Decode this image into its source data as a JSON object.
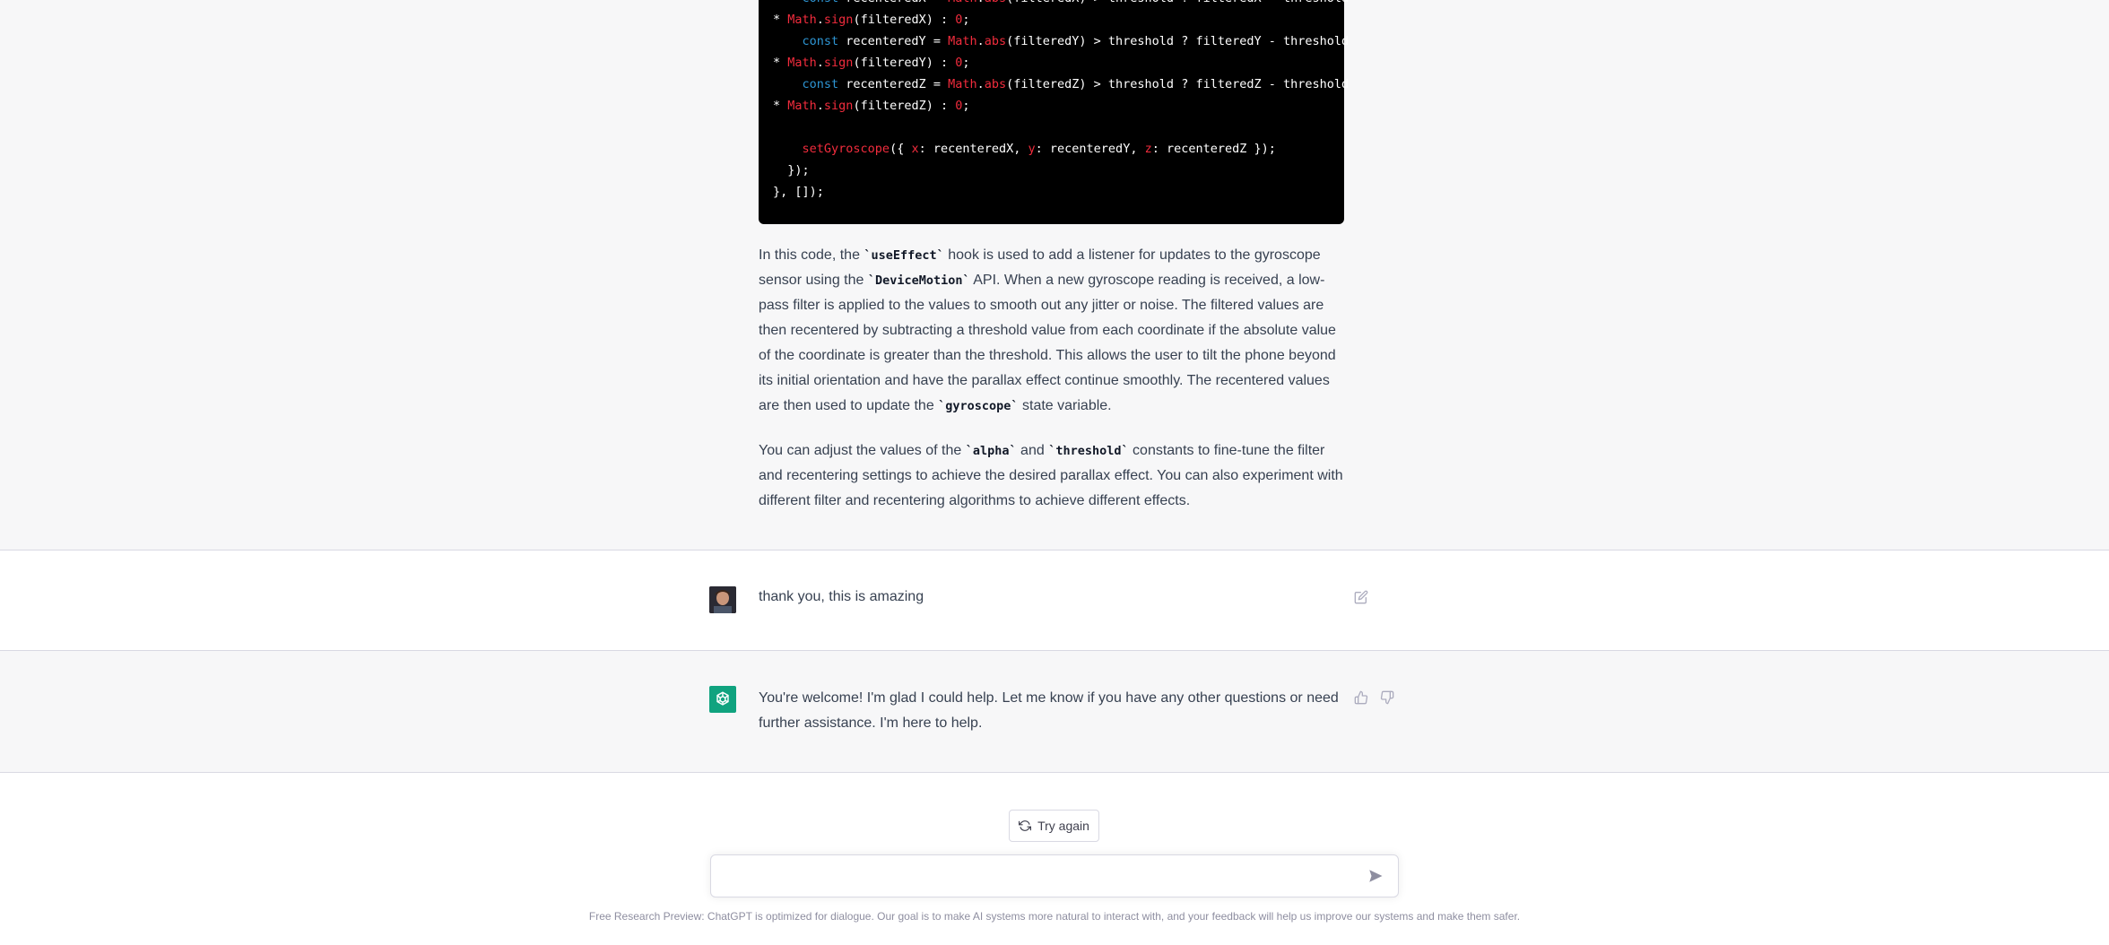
{
  "code": {
    "lines": [
      {
        "indent": "    ",
        "parts": [
          [
            "kw",
            "const"
          ],
          [
            "plain",
            " recenteredX = "
          ],
          [
            "fn",
            "Math"
          ],
          [
            "plain",
            "."
          ],
          [
            "fn",
            "abs"
          ],
          [
            "plain",
            "(filteredX) > threshold ? filteredX - threshold"
          ]
        ]
      },
      {
        "indent": "",
        "parts": [
          [
            "plain",
            "* "
          ],
          [
            "fn",
            "Math"
          ],
          [
            "plain",
            "."
          ],
          [
            "fn",
            "sign"
          ],
          [
            "plain",
            "(filteredX) : "
          ],
          [
            "red",
            "0"
          ],
          [
            "plain",
            ";"
          ]
        ]
      },
      {
        "indent": "    ",
        "parts": [
          [
            "kw",
            "const"
          ],
          [
            "plain",
            " recenteredY = "
          ],
          [
            "fn",
            "Math"
          ],
          [
            "plain",
            "."
          ],
          [
            "fn",
            "abs"
          ],
          [
            "plain",
            "(filteredY) > threshold ? filteredY - threshold"
          ]
        ]
      },
      {
        "indent": "",
        "parts": [
          [
            "plain",
            "* "
          ],
          [
            "fn",
            "Math"
          ],
          [
            "plain",
            "."
          ],
          [
            "fn",
            "sign"
          ],
          [
            "plain",
            "(filteredY) : "
          ],
          [
            "red",
            "0"
          ],
          [
            "plain",
            ";"
          ]
        ]
      },
      {
        "indent": "    ",
        "parts": [
          [
            "kw",
            "const"
          ],
          [
            "plain",
            " recenteredZ = "
          ],
          [
            "fn",
            "Math"
          ],
          [
            "plain",
            "."
          ],
          [
            "fn",
            "abs"
          ],
          [
            "plain",
            "(filteredZ) > threshold ? filteredZ - threshold"
          ]
        ]
      },
      {
        "indent": "",
        "parts": [
          [
            "plain",
            "* "
          ],
          [
            "fn",
            "Math"
          ],
          [
            "plain",
            "."
          ],
          [
            "fn",
            "sign"
          ],
          [
            "plain",
            "(filteredZ) : "
          ],
          [
            "red",
            "0"
          ],
          [
            "plain",
            ";"
          ]
        ]
      },
      {
        "indent": "",
        "parts": []
      },
      {
        "indent": "    ",
        "parts": [
          [
            "fn",
            "setGyroscope"
          ],
          [
            "plain",
            "({ "
          ],
          [
            "red",
            "x"
          ],
          [
            "plain",
            ": recenteredX, "
          ],
          [
            "red",
            "y"
          ],
          [
            "plain",
            ": recenteredY, "
          ],
          [
            "red",
            "z"
          ],
          [
            "plain",
            ": recenteredZ });"
          ]
        ]
      },
      {
        "indent": "  ",
        "parts": [
          [
            "plain",
            "});"
          ]
        ]
      },
      {
        "indent": "",
        "parts": [
          [
            "plain",
            "}, []);"
          ]
        ]
      }
    ]
  },
  "explanation": {
    "p1_parts": [
      [
        "text",
        "In this code, the "
      ],
      [
        "code",
        "`useEffect`"
      ],
      [
        "text",
        " hook is used to add a listener for updates to the gyroscope sensor using the "
      ],
      [
        "code",
        "`DeviceMotion`"
      ],
      [
        "text",
        " API. When a new gyroscope reading is received, a low-pass filter is applied to the values to smooth out any jitter or noise. The filtered values are then recentered by subtracting a threshold value from each coordinate if the absolute value of the coordinate is greater than the threshold. This allows the user to tilt the phone beyond its initial orientation and have the parallax effect continue smoothly. The recentered values are then used to update the "
      ],
      [
        "code",
        "`gyroscope`"
      ],
      [
        "text",
        " state variable."
      ]
    ],
    "p2_parts": [
      [
        "text",
        "You can adjust the values of the "
      ],
      [
        "code",
        "`alpha`"
      ],
      [
        "text",
        " and "
      ],
      [
        "code",
        "`threshold`"
      ],
      [
        "text",
        " constants to fine-tune the filter and recentering settings to achieve the desired parallax effect. You can also experiment with different filter and recentering algorithms to achieve different effects."
      ]
    ]
  },
  "user_message": {
    "text": "thank you, this is amazing",
    "edit_icon": "edit-icon"
  },
  "assistant_message": {
    "text": "You're welcome! I'm glad I could help. Let me know if you have any other questions or need further assistance. I'm here to help.",
    "thumbs_up_icon": "thumbs-up-icon",
    "thumbs_down_icon": "thumbs-down-icon"
  },
  "try_again": {
    "label": "Try again",
    "icon": "refresh-icon"
  },
  "composer": {
    "value": "",
    "placeholder": "",
    "send_icon": "send-icon"
  },
  "footer": {
    "text": "Free Research Preview: ChatGPT is optimized for dialogue. Our goal is to make AI systems more natural to interact with, and your feedback will help us improve our systems and make them safer."
  },
  "colors": {
    "assistant_bg": "#f7f7f8",
    "code_bg": "#000000",
    "keyword": "#2e95d3",
    "function": "#f22c3d",
    "brand": "#10a37f"
  }
}
